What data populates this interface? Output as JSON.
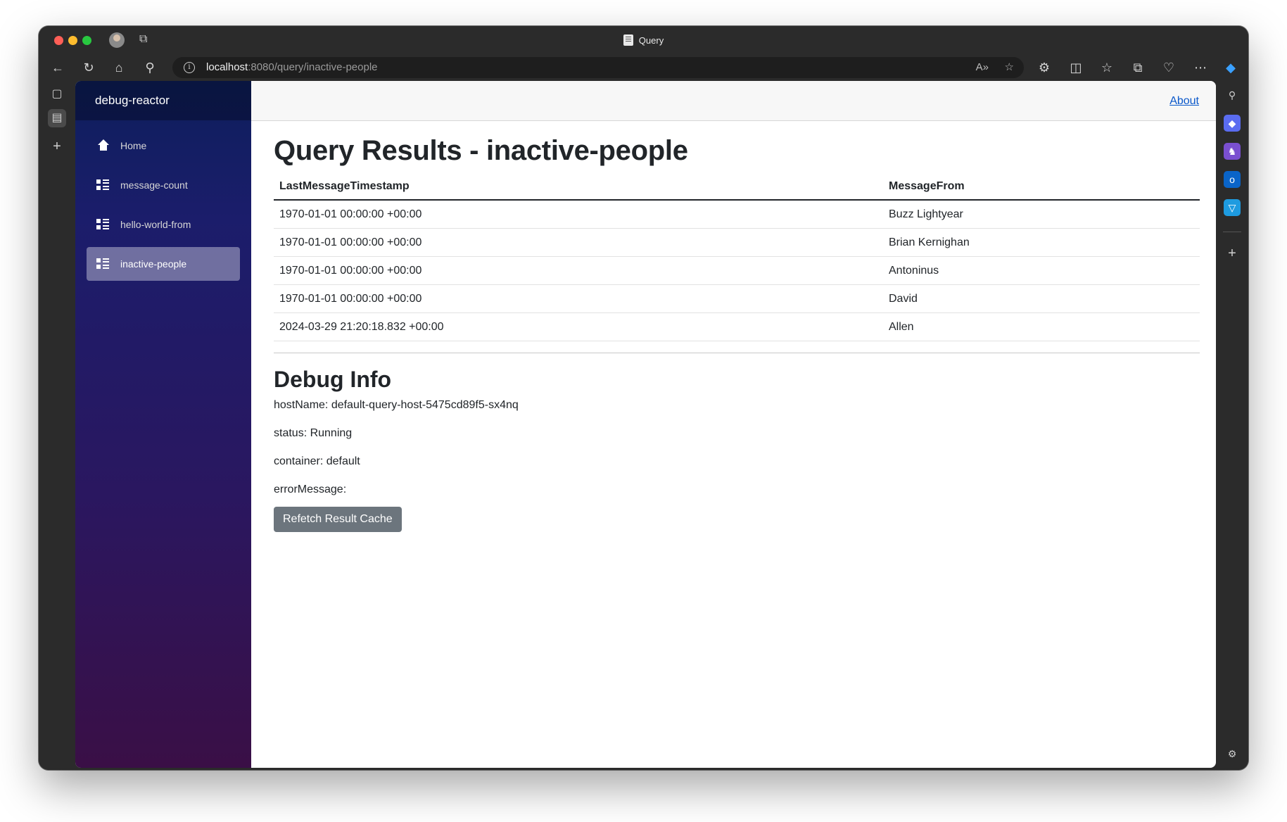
{
  "browser": {
    "tab_title": "Query",
    "address_host": "localhost",
    "address_rest": ":8080/query/inactive-people"
  },
  "sidebar": {
    "brand": "debug-reactor",
    "items": [
      {
        "label": "Home",
        "icon": "home-icon"
      },
      {
        "label": "message-count",
        "icon": "list-icon"
      },
      {
        "label": "hello-world-from",
        "icon": "list-icon"
      },
      {
        "label": "inactive-people",
        "icon": "list-icon",
        "active": true
      }
    ]
  },
  "topbar": {
    "about_label": "About"
  },
  "page": {
    "title": "Query Results - inactive-people",
    "table": {
      "headers": [
        "LastMessageTimestamp",
        "MessageFrom"
      ],
      "rows": [
        [
          "1970-01-01 00:00:00 +00:00",
          "Buzz Lightyear"
        ],
        [
          "1970-01-01 00:00:00 +00:00",
          "Brian Kernighan"
        ],
        [
          "1970-01-01 00:00:00 +00:00",
          "Antoninus"
        ],
        [
          "1970-01-01 00:00:00 +00:00",
          "David"
        ],
        [
          "2024-03-29 21:20:18.832 +00:00",
          "Allen"
        ]
      ]
    },
    "debug": {
      "heading": "Debug Info",
      "hostName": "hostName: default-query-host-5475cd89f5-sx4nq",
      "status": "status: Running",
      "container": "container: default",
      "errorMessage": "errorMessage:",
      "button_label": "Refetch Result Cache"
    }
  }
}
